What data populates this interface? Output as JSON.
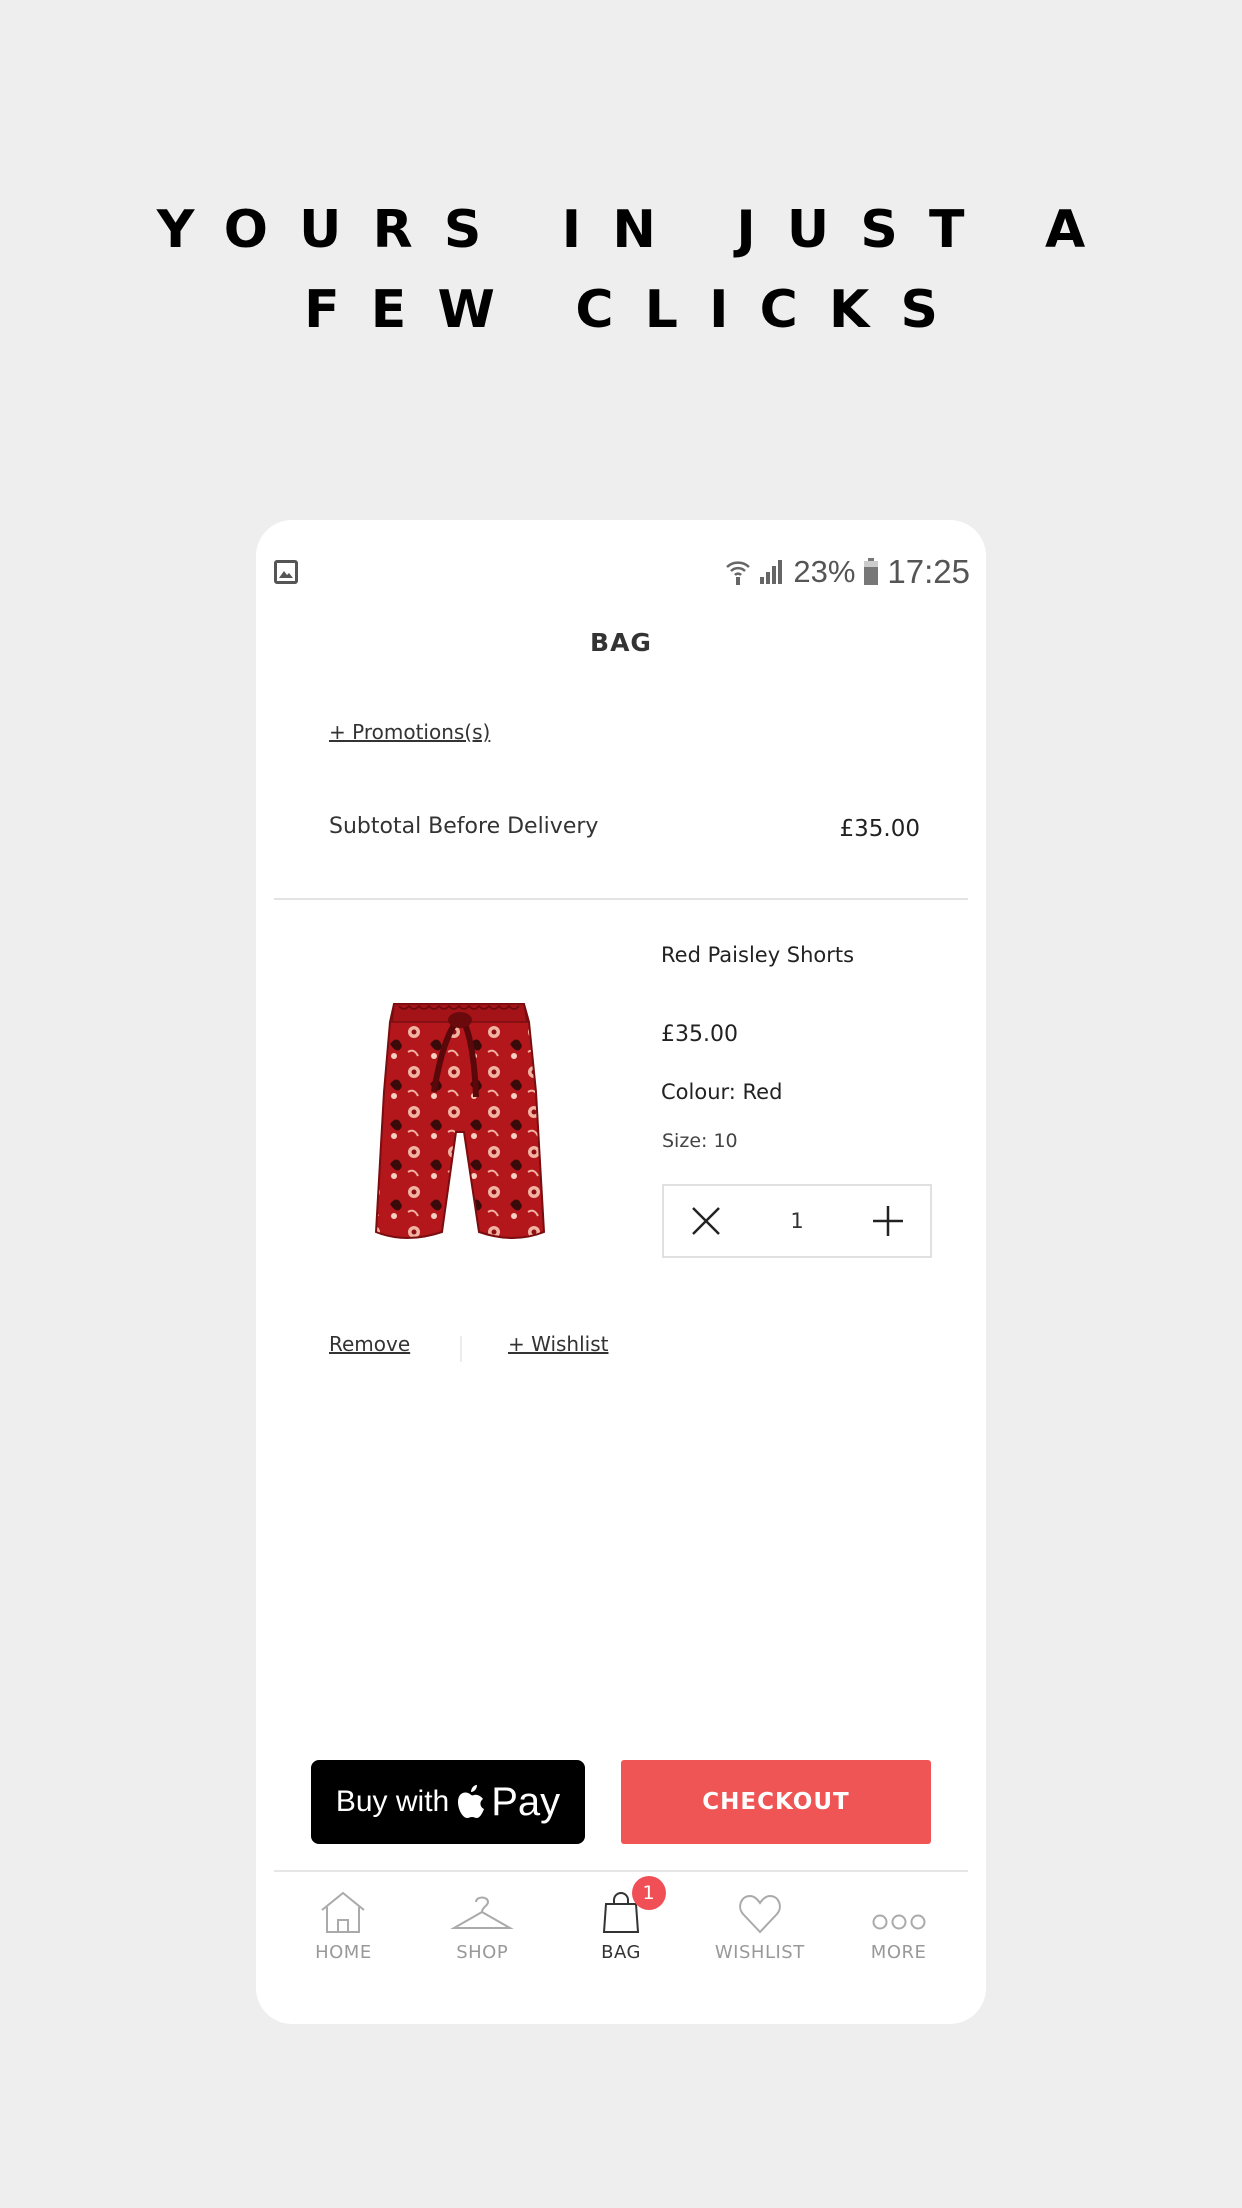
{
  "headline": {
    "line1": "YOURS IN JUST A",
    "line2": "FEW CLICKS"
  },
  "status_bar": {
    "battery": "23%",
    "time": "17:25",
    "icons": [
      "image-icon",
      "wifi-icon",
      "signal-icon",
      "battery-icon"
    ]
  },
  "page": {
    "title": "BAG",
    "promotions_link": "+ Promotions(s)"
  },
  "subtotal": {
    "label": "Subtotal Before Delivery",
    "value": "£35.00"
  },
  "product": {
    "name": "Red Paisley Shorts",
    "price": "£35.00",
    "colour": "Colour: Red",
    "size": "Size: 10",
    "quantity": "1",
    "image_icon": "red-paisley-shorts"
  },
  "actions": {
    "remove": "Remove",
    "wishlist": "+ Wishlist"
  },
  "buttons": {
    "applepay_buy": "Buy with",
    "applepay_pay": "Pay",
    "checkout": "CHECKOUT"
  },
  "nav": {
    "items": [
      {
        "label": "HOME",
        "icon": "home-icon"
      },
      {
        "label": "SHOP",
        "icon": "hanger-icon"
      },
      {
        "label": "BAG",
        "icon": "bag-icon",
        "active": true,
        "badge": "1"
      },
      {
        "label": "WISHLIST",
        "icon": "heart-icon"
      },
      {
        "label": "MORE",
        "icon": "more-icon"
      }
    ]
  },
  "colors": {
    "background": "#eeeeee",
    "checkout": "#f05555",
    "badge": "#ef4f55",
    "applepay": "#000000"
  }
}
